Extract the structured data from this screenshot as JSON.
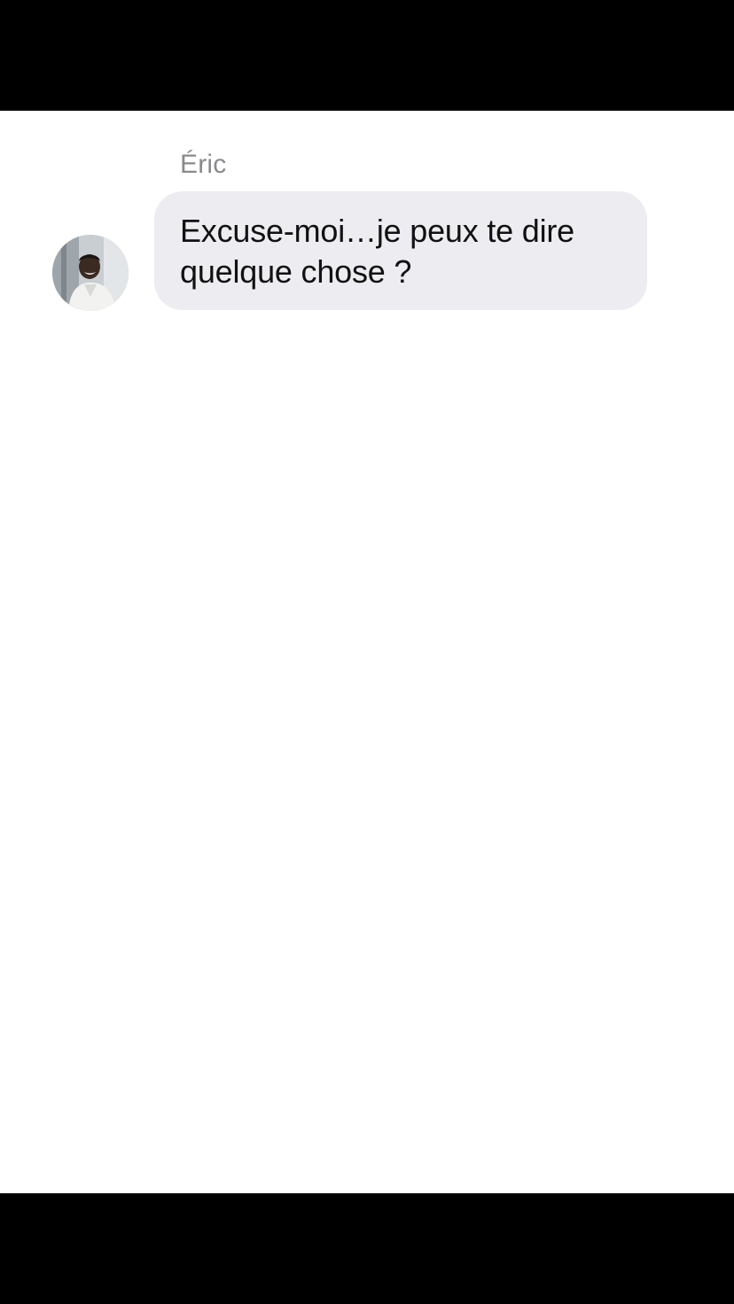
{
  "conversation": {
    "sender": {
      "name": "Éric",
      "avatar_icon": "contact-photo"
    },
    "messages": [
      {
        "text": "Excuse-moi…je peux te dire quelque chose ?"
      }
    ]
  },
  "colors": {
    "bubble_background": "#ececf1",
    "name_text": "#8a8a8e",
    "message_text": "#111111",
    "letterbox": "#000000"
  }
}
